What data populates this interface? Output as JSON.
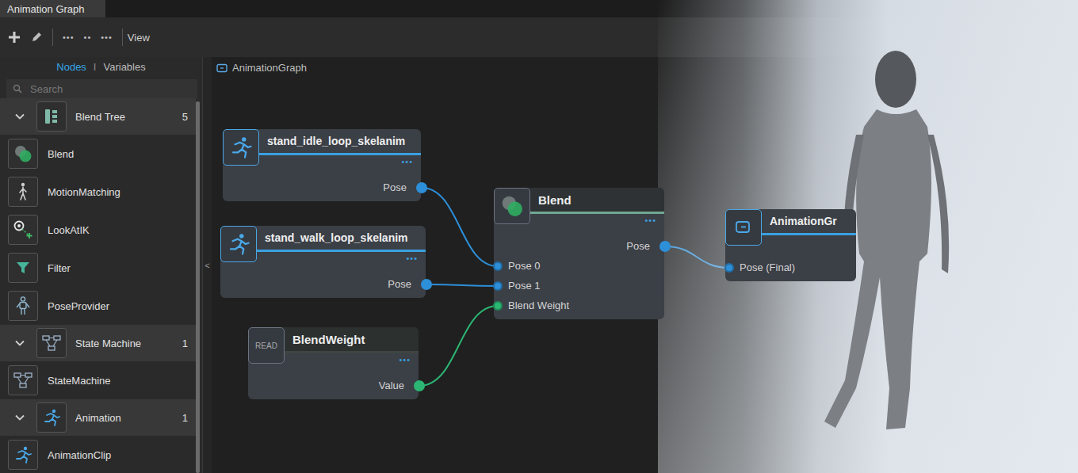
{
  "window": {
    "title": "Animation Graph"
  },
  "toolbar": {
    "groups": [
      "•••",
      "••",
      "•••"
    ],
    "view": "View"
  },
  "sidebar": {
    "tabs": [
      {
        "label": "Nodes",
        "selected": true
      },
      {
        "label": "Variables",
        "selected": false
      }
    ],
    "tab_separator": "I",
    "search": {
      "placeholder": "Search"
    },
    "categories": [
      {
        "name": "Blend Tree",
        "count": "5",
        "expanded": true,
        "items": [
          "Blend",
          "MotionMatching",
          "LookAtIK",
          "Filter",
          "PoseProvider"
        ]
      },
      {
        "name": "State Machine",
        "count": "1",
        "expanded": true,
        "items": [
          "StateMachine"
        ]
      },
      {
        "name": "Animation",
        "count": "1",
        "expanded": true,
        "items": [
          "AnimationClip"
        ]
      }
    ],
    "collapse": "<"
  },
  "canvas": {
    "breadcrumb": "AnimationGraph",
    "nodes": [
      {
        "kind": "clip",
        "title": "stand_idle_loop_skelanim",
        "menu": "•••",
        "ports": [
          {
            "label": "Pose",
            "dir": "out",
            "color": "#2d8fd8"
          }
        ]
      },
      {
        "kind": "clip",
        "title": "stand_walk_loop_skelanim",
        "menu": "•••",
        "ports": [
          {
            "label": "Pose",
            "dir": "out",
            "color": "#2d8fd8"
          }
        ]
      },
      {
        "kind": "variable",
        "badge": "READ",
        "title": "BlendWeight",
        "menu": "•••",
        "ports": [
          {
            "label": "Value",
            "dir": "out",
            "color": "#2bb673"
          }
        ]
      },
      {
        "kind": "blend",
        "title": "Blend",
        "menu": "•••",
        "ports": [
          {
            "label": "Pose",
            "dir": "out",
            "color": "#2d8fd8"
          },
          {
            "label": "Pose 0",
            "dir": "in",
            "color": "#2d8fd8"
          },
          {
            "label": "Pose 1",
            "dir": "in",
            "color": "#2d8fd8"
          },
          {
            "label": "Blend Weight",
            "dir": "in",
            "color": "#2bb673"
          }
        ]
      },
      {
        "kind": "output",
        "title": "AnimationGr",
        "ports": [
          {
            "label": "Pose (Final)",
            "dir": "in",
            "color": "#2d8fd8"
          }
        ]
      }
    ],
    "edges": [
      {
        "from": [
          0,
          0
        ],
        "to": [
          3,
          1
        ]
      },
      {
        "from": [
          1,
          0
        ],
        "to": [
          3,
          2
        ]
      },
      {
        "from": [
          2,
          0
        ],
        "to": [
          3,
          3
        ]
      },
      {
        "from": [
          3,
          0
        ],
        "to": [
          4,
          0
        ]
      }
    ]
  }
}
